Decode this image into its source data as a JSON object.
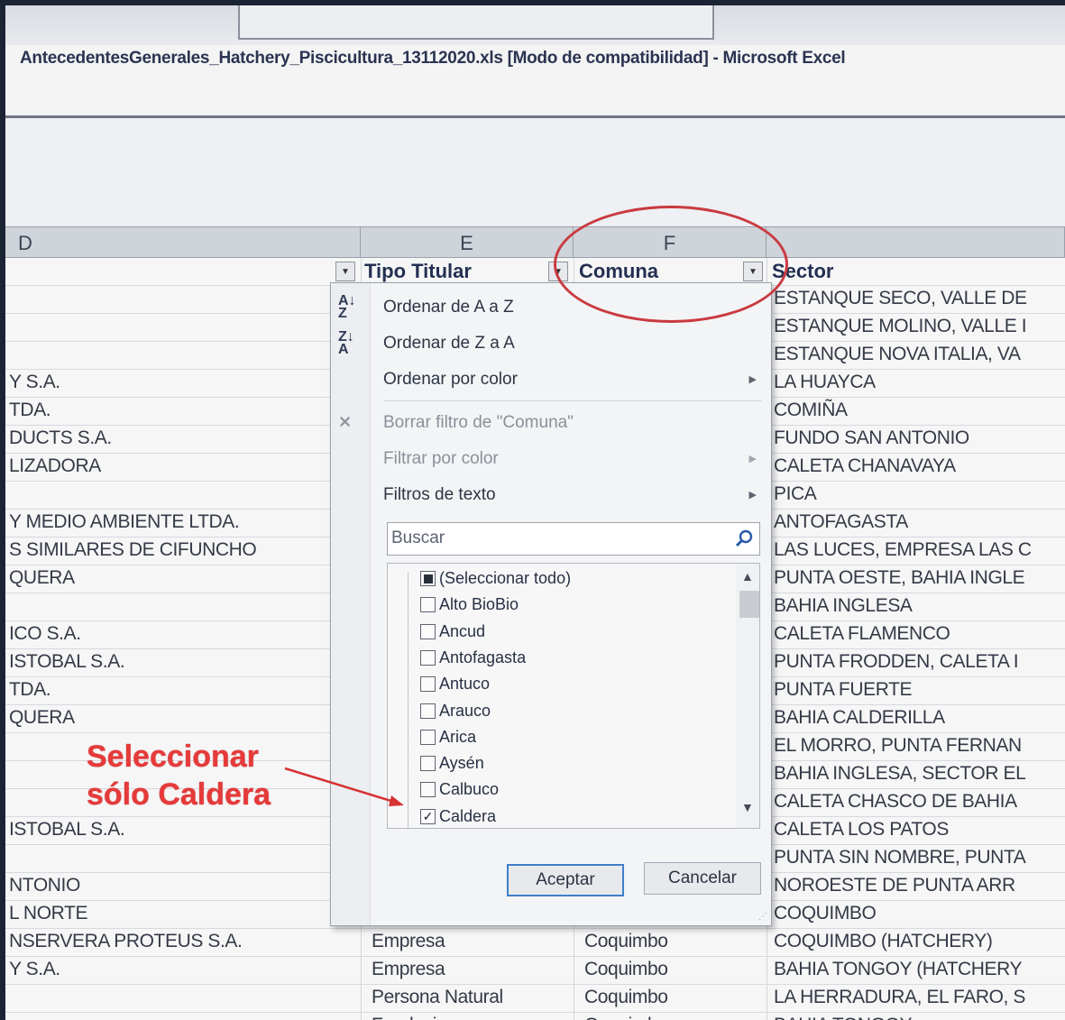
{
  "window": {
    "title": "AntecedentesGenerales_Hatchery_Piscicultura_13112020.xls  [Modo de compatibilidad]  -  Microsoft Excel"
  },
  "columns": {
    "d": "D",
    "e": "E",
    "f": "F"
  },
  "header_row": {
    "tipo_titular": "Tipo Titular",
    "comuna": "Comuna",
    "sector": "Sector"
  },
  "col_d_rows": [
    "",
    "",
    "",
    "Y S.A.",
    "TDA.",
    "DUCTS S.A.",
    "LIZADORA",
    "",
    "Y MEDIO AMBIENTE LTDA.",
    "S SIMILARES DE CIFUNCHO",
    "QUERA",
    "",
    "ICO S.A.",
    "ISTOBAL S.A.",
    "TDA.",
    "QUERA",
    "",
    "",
    "",
    "ISTOBAL S.A.",
    "",
    "NTONIO",
    "L NORTE",
    "NSERVERA PROTEUS S.A.",
    "Y S.A."
  ],
  "col_e_rows": [
    "Empresa",
    "Empresa",
    "Persona Natural",
    "Fundacion"
  ],
  "col_f_rows": [
    "Coquimbo",
    "Coquimbo",
    "Coquimbo",
    "Coquimbo"
  ],
  "sector_rows": [
    "ESTANQUE SECO, VALLE DE",
    "ESTANQUE MOLINO, VALLE I",
    "ESTANQUE NOVA ITALIA, VA",
    "LA HUAYCA",
    "COMIÑA",
    "FUNDO SAN ANTONIO",
    "CALETA CHANAVAYA",
    "PICA",
    "ANTOFAGASTA",
    "LAS LUCES, EMPRESA LAS C",
    "PUNTA OESTE, BAHIA INGLE",
    "BAHIA INGLESA",
    "CALETA FLAMENCO",
    "PUNTA FRODDEN, CALETA I",
    "PUNTA FUERTE",
    "BAHIA CALDERILLA",
    "EL MORRO, PUNTA FERNAN",
    "BAHIA INGLESA, SECTOR EL",
    "CALETA CHASCO DE BAHIA",
    "CALETA LOS PATOS",
    "PUNTA SIN NOMBRE, PUNTA",
    "NOROESTE DE PUNTA ARR",
    "COQUIMBO",
    "COQUIMBO (HATCHERY)",
    "BAHIA TONGOY (HATCHERY",
    "LA HERRADURA, EL FARO, S",
    "BAHIA TONGOY"
  ],
  "filter_menu": {
    "sort_az": "Ordenar de A a Z",
    "sort_za": "Ordenar de Z a A",
    "sort_color": "Ordenar por color",
    "clear_filter": "Borrar filtro de \"Comuna\"",
    "filter_color": "Filtrar por color",
    "text_filters": "Filtros de texto",
    "search_placeholder": "Buscar",
    "items": [
      {
        "label": "(Seleccionar todo)",
        "state": "partial"
      },
      {
        "label": "Alto BioBio",
        "state": "unchecked"
      },
      {
        "label": "Ancud",
        "state": "unchecked"
      },
      {
        "label": "Antofagasta",
        "state": "unchecked"
      },
      {
        "label": "Antuco",
        "state": "unchecked"
      },
      {
        "label": "Arauco",
        "state": "unchecked"
      },
      {
        "label": "Arica",
        "state": "unchecked"
      },
      {
        "label": "Aysén",
        "state": "unchecked"
      },
      {
        "label": "Calbuco",
        "state": "unchecked"
      },
      {
        "label": "Caldera",
        "state": "checked"
      }
    ],
    "ok": "Aceptar",
    "cancel": "Cancelar"
  },
  "annotation": {
    "line1": "Seleccionar",
    "line2": "sólo Caldera",
    "color": "#e63a3a"
  }
}
